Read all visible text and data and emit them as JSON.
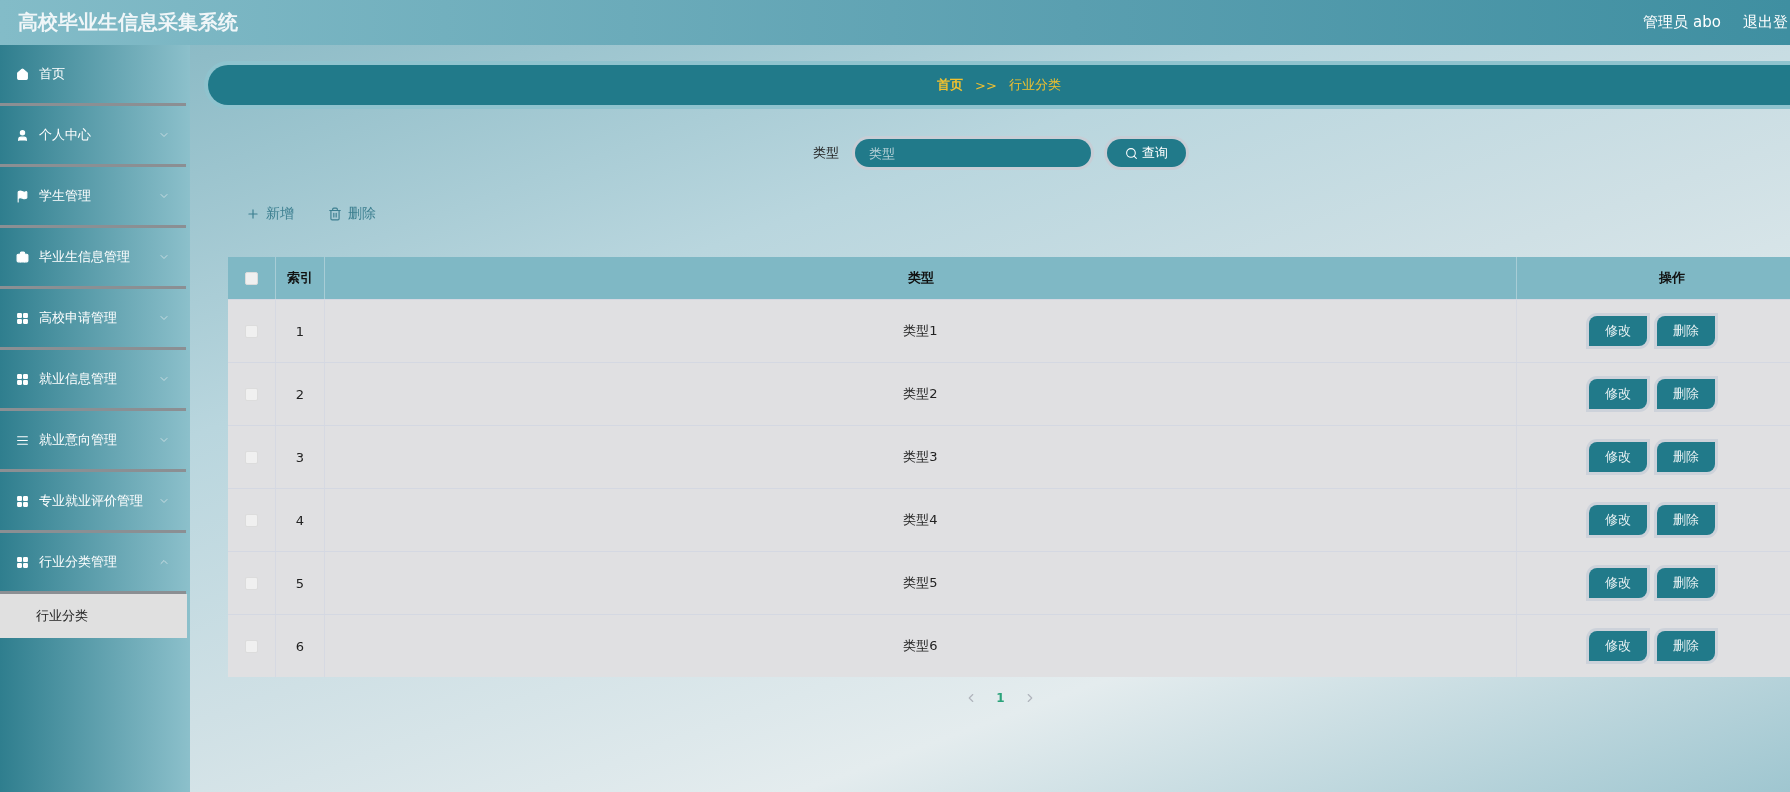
{
  "header": {
    "title": "高校毕业生信息采集系统",
    "user": "管理员 abo",
    "logout": "退出登"
  },
  "sidebar": {
    "items": [
      {
        "label": "首页",
        "kind": "link"
      },
      {
        "label": "个人中心",
        "kind": "menu",
        "expanded": false
      },
      {
        "label": "学生管理",
        "kind": "menu",
        "expanded": false
      },
      {
        "label": "毕业生信息管理",
        "kind": "menu",
        "expanded": false
      },
      {
        "label": "高校申请管理",
        "kind": "menu",
        "expanded": false
      },
      {
        "label": "就业信息管理",
        "kind": "menu",
        "expanded": false
      },
      {
        "label": "就业意向管理",
        "kind": "menu",
        "expanded": false
      },
      {
        "label": "专业就业评价管理",
        "kind": "menu",
        "expanded": false
      },
      {
        "label": "行业分类管理",
        "kind": "menu",
        "expanded": true,
        "children": [
          {
            "label": "行业分类",
            "selected": true
          }
        ]
      }
    ]
  },
  "breadcrumb": {
    "items": [
      "首页",
      "行业分类"
    ],
    "separator": ">>"
  },
  "search": {
    "label": "类型",
    "placeholder": "类型",
    "button": "查询"
  },
  "toolbar": [
    {
      "label": "新增",
      "kind": "add"
    },
    {
      "label": "删除",
      "kind": "delete"
    }
  ],
  "table": {
    "select_all": false,
    "columns": [
      "索引",
      "类型",
      "操作"
    ],
    "rows": [
      {
        "checked": false,
        "index": "1",
        "type": "类型1",
        "actions": [
          "修改",
          "删除"
        ]
      },
      {
        "checked": false,
        "index": "2",
        "type": "类型2",
        "actions": [
          "修改",
          "删除"
        ]
      },
      {
        "checked": false,
        "index": "3",
        "type": "类型3",
        "actions": [
          "修改",
          "删除"
        ]
      },
      {
        "checked": false,
        "index": "4",
        "type": "类型4",
        "actions": [
          "修改",
          "删除"
        ]
      },
      {
        "checked": false,
        "index": "5",
        "type": "类型5",
        "actions": [
          "修改",
          "删除"
        ]
      },
      {
        "checked": false,
        "index": "6",
        "type": "类型6",
        "actions": [
          "修改",
          "删除"
        ]
      }
    ]
  },
  "pagination": {
    "pages": [
      {
        "label": "1",
        "selected": true
      }
    ]
  }
}
